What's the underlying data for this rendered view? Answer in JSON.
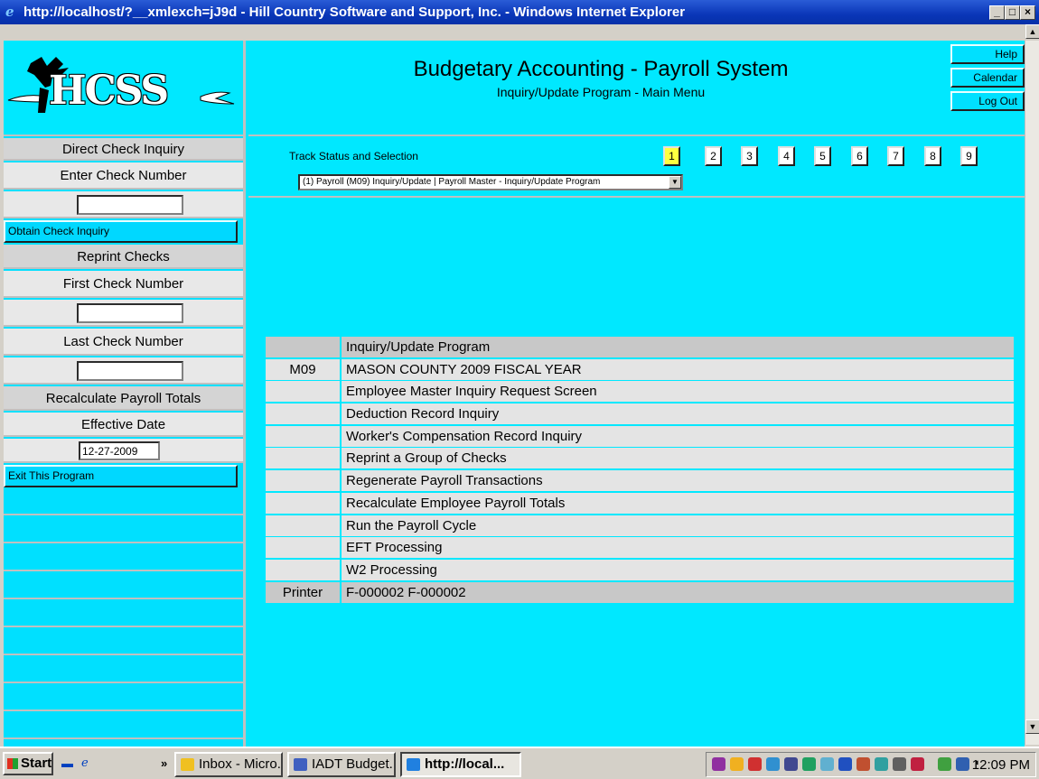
{
  "window": {
    "title": "http://localhost/?__xmlexch=jJ9d - Hill Country Software and Support, Inc. - Windows Internet Explorer"
  },
  "logo": {
    "text": "HCSS"
  },
  "header": {
    "title": "Budgetary Accounting - Payroll System",
    "subtitle": "Inquiry/Update Program - Main Menu",
    "buttons": {
      "help": "Help",
      "calendar": "Calendar",
      "logout": "Log Out"
    }
  },
  "track": {
    "label": "Track Status and Selection",
    "steps": [
      "1",
      "2",
      "3",
      "4",
      "5",
      "6",
      "7",
      "8",
      "9"
    ],
    "active_step": "1",
    "selected": "(1) Payroll (M09) Inquiry/Update | Payroll Master - Inquiry/Update Program"
  },
  "sidebar": {
    "direct_check_inquiry": "Direct Check Inquiry",
    "enter_check_number": "Enter Check Number",
    "check_number_value": "",
    "obtain_check_inquiry": "Obtain Check Inquiry",
    "reprint_checks": "Reprint Checks",
    "first_check_number": "First Check Number",
    "first_check_value": "",
    "last_check_number": "Last Check Number",
    "last_check_value": "",
    "recalculate_totals": "Recalculate Payroll Totals",
    "effective_date": "Effective Date",
    "effective_date_value": "12-27-2009",
    "exit_program": "Exit This Program"
  },
  "menu": {
    "rows": [
      {
        "code": "",
        "label": "Inquiry/Update Program"
      },
      {
        "code": "M09",
        "label": "MASON COUNTY 2009 FISCAL YEAR"
      },
      {
        "code": "",
        "label": "Employee Master Inquiry Request Screen"
      },
      {
        "code": "",
        "label": "Deduction Record Inquiry"
      },
      {
        "code": "",
        "label": "Worker's Compensation Record Inquiry"
      },
      {
        "code": "",
        "label": "Reprint a Group of Checks"
      },
      {
        "code": "",
        "label": "Regenerate Payroll Transactions"
      },
      {
        "code": "",
        "label": "Recalculate Employee Payroll Totals"
      },
      {
        "code": "",
        "label": "Run the Payroll Cycle"
      },
      {
        "code": "",
        "label": "EFT Processing"
      },
      {
        "code": "",
        "label": "W2 Processing"
      },
      {
        "code": "Printer",
        "label": "F-000002 F-000002"
      }
    ]
  },
  "taskbar": {
    "start": "Start",
    "overflow": "»",
    "tasks": [
      "Inbox - Micro...",
      "IADT Budget...",
      "http://local..."
    ],
    "clock": "12:09 PM"
  }
}
